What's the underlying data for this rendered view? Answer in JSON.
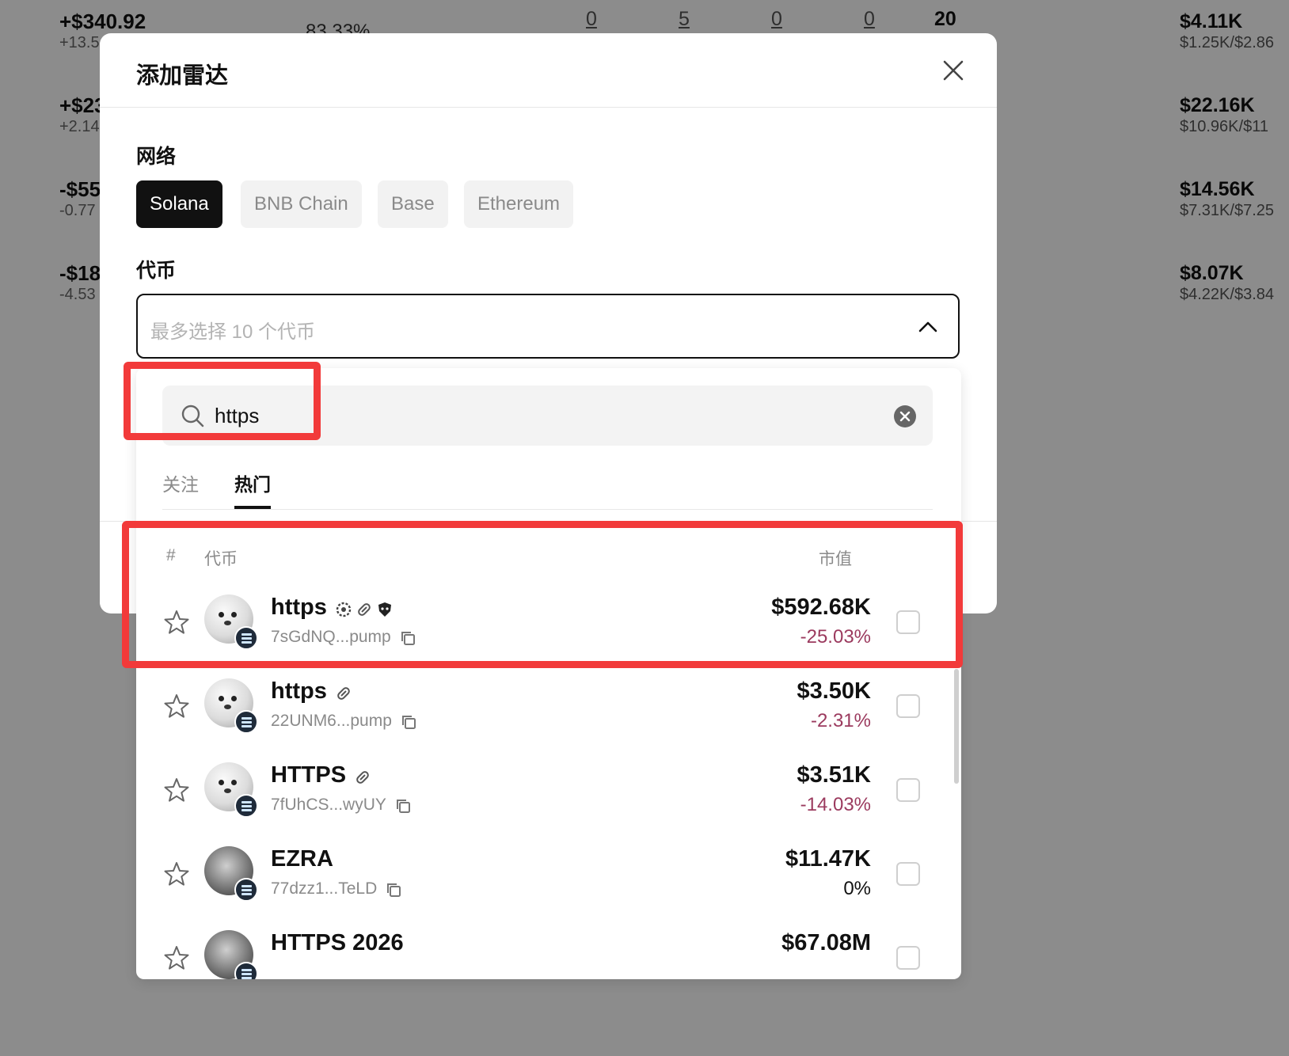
{
  "background": {
    "pnl_rows": [
      {
        "main": "+$340.92",
        "sub": "+13.5"
      },
      {
        "main": "+$23",
        "sub": "+2.14"
      },
      {
        "main": "-$55",
        "sub": "-0.77"
      },
      {
        "main": "-$18",
        "sub": "-4.53"
      }
    ],
    "percent": "83.33%",
    "counts": [
      "0",
      "5",
      "0",
      "0"
    ],
    "total": "20",
    "market_rows": [
      {
        "main": "$4.11K",
        "sub": "$1.25K/$2.86"
      },
      {
        "main": "$22.16K",
        "sub": "$10.96K/$11"
      },
      {
        "main": "$14.56K",
        "sub": "$7.31K/$7.25"
      },
      {
        "main": "$8.07K",
        "sub": "$4.22K/$3.84"
      }
    ]
  },
  "modal": {
    "title": "添加雷达",
    "network_label": "网络",
    "networks": [
      "Solana",
      "BNB Chain",
      "Base",
      "Ethereum"
    ],
    "selected_network": "Solana",
    "token_label": "代币",
    "token_placeholder": "最多选择 10 个代币"
  },
  "dropdown": {
    "search_value": "https",
    "tabs": [
      "关注",
      "热门"
    ],
    "active_tab": "热门",
    "columns": {
      "index": "#",
      "token": "代币",
      "market_cap": "市值"
    },
    "tokens": [
      {
        "name": "https",
        "address": "7sGdNQ...pump",
        "market_cap": "$592.68K",
        "change": "-25.03%",
        "tags": [
          "dev-icon",
          "pill-icon",
          "shield-icon"
        ]
      },
      {
        "name": "https",
        "address": "22UNM6...pump",
        "market_cap": "$3.50K",
        "change": "-2.31%",
        "tags": [
          "pill-icon"
        ]
      },
      {
        "name": "HTTPS",
        "address": "7fUhCS...wyUY",
        "market_cap": "$3.51K",
        "change": "-14.03%",
        "tags": [
          "pill-icon"
        ]
      },
      {
        "name": "EZRA",
        "address": "77dzz1...TeLD",
        "market_cap": "$11.47K",
        "change": "0%",
        "tags": []
      },
      {
        "name": "HTTPS 2026",
        "address": "",
        "market_cap": "$67.08M",
        "change": "",
        "tags": []
      }
    ]
  },
  "colors": {
    "highlight": "#f23a3a",
    "negative": "#9b3a5e",
    "primary": "#111111"
  }
}
